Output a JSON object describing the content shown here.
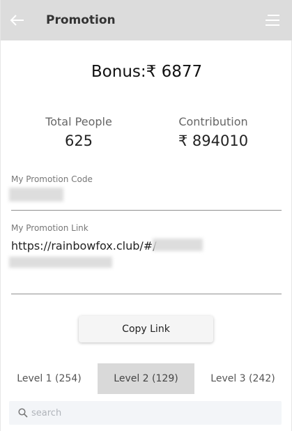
{
  "header": {
    "title": "Promotion",
    "back_icon": "arrow-left-icon",
    "menu_icon": "menu-lines-icon"
  },
  "bonus": {
    "text": "Bonus:₹ 6877"
  },
  "stats": {
    "total_people_label": "Total People",
    "total_people_value": "625",
    "contribution_label": "Contribution",
    "contribution_value": "₹ 894010"
  },
  "promotion_code": {
    "label": "My Promotion Code"
  },
  "promotion_link": {
    "label": "My Promotion Link",
    "visible_url": "https://rainbowfox.club/#/"
  },
  "copy_button": {
    "label": "Copy Link"
  },
  "tabs": [
    {
      "label": "Level 1  (254)",
      "active": false
    },
    {
      "label": "Level 2  (129)",
      "active": true
    },
    {
      "label": "Level 3  (242)",
      "active": false
    }
  ],
  "search": {
    "placeholder": "search",
    "value": ""
  },
  "colors": {
    "header_bg": "#dcdcdc",
    "active_tab_bg": "#d9d9d9",
    "search_bg": "#f3f5f8"
  }
}
